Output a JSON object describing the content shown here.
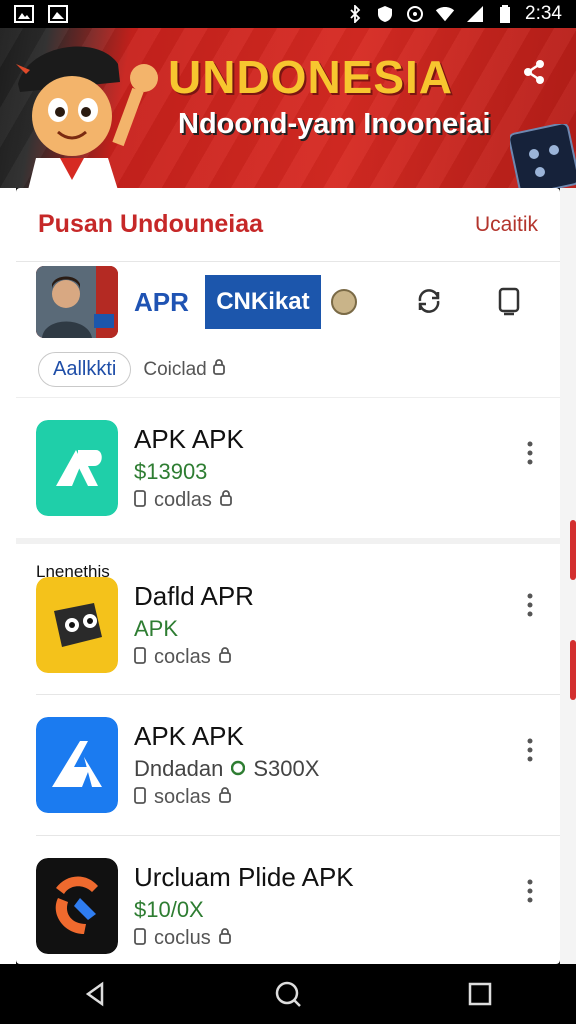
{
  "status_bar": {
    "time": "2:34"
  },
  "banner": {
    "title": "UNDONESIA",
    "subtitle": "Ndoond-yam Inooneiai"
  },
  "header": {
    "title": "Pusan Undouneiaa",
    "action": "Ucaitik"
  },
  "brand_row": {
    "apr_label": "APR",
    "box_label": "CNKikat"
  },
  "chips": {
    "primary": "Aallkkti",
    "secondary": "Coiclad"
  },
  "apps": [
    {
      "name": "APK APK",
      "meta": "$13903",
      "sub": "codlas",
      "section": ""
    },
    {
      "name": "Dafld APR",
      "meta": "APK",
      "sub": "coclas",
      "section": "Lnenethis"
    },
    {
      "name": "APK APK",
      "meta": "Dndadan",
      "meta_extra": "S300X",
      "sub": "soclas",
      "section": ""
    },
    {
      "name": "Urcluam Plide APK",
      "meta": "$10/0X",
      "sub": "coclus",
      "section": ""
    }
  ],
  "colors": {
    "banner_red": "#d62a22",
    "banner_yellow": "#f7c62f",
    "title_red": "#c62828",
    "brand_blue": "#1c56ac",
    "meta_green": "#2e7d32"
  }
}
